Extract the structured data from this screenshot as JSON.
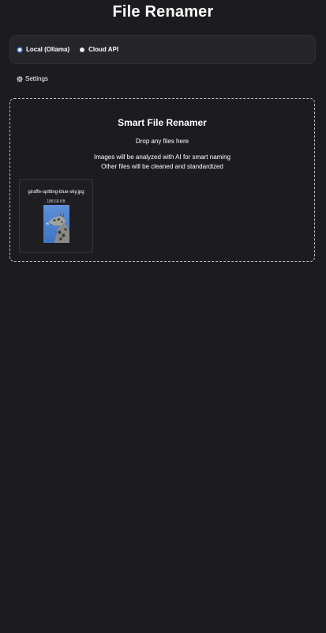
{
  "header": {
    "title": "File Renamer"
  },
  "mode": {
    "options": [
      {
        "label": "Local (Ollama)",
        "selected": true
      },
      {
        "label": "Cloud API",
        "selected": false
      }
    ],
    "accent_color": "#3d8bff"
  },
  "settings": {
    "label": "Settings",
    "icon": "gear-icon"
  },
  "drop_zone": {
    "title": "Smart File Renamer",
    "subtitle": "Drop any files here",
    "info_line_1": "Images will be analyzed with AI for smart naming",
    "info_line_2": "Other files will be cleaned and standardized"
  },
  "files": [
    {
      "name": "giraffe-spitting-blue-sky.jpg",
      "size": "188.68 KB",
      "thumbnail": "giraffe-photo"
    }
  ],
  "colors": {
    "background": "#1c1b1f",
    "panel": "#26252a"
  }
}
